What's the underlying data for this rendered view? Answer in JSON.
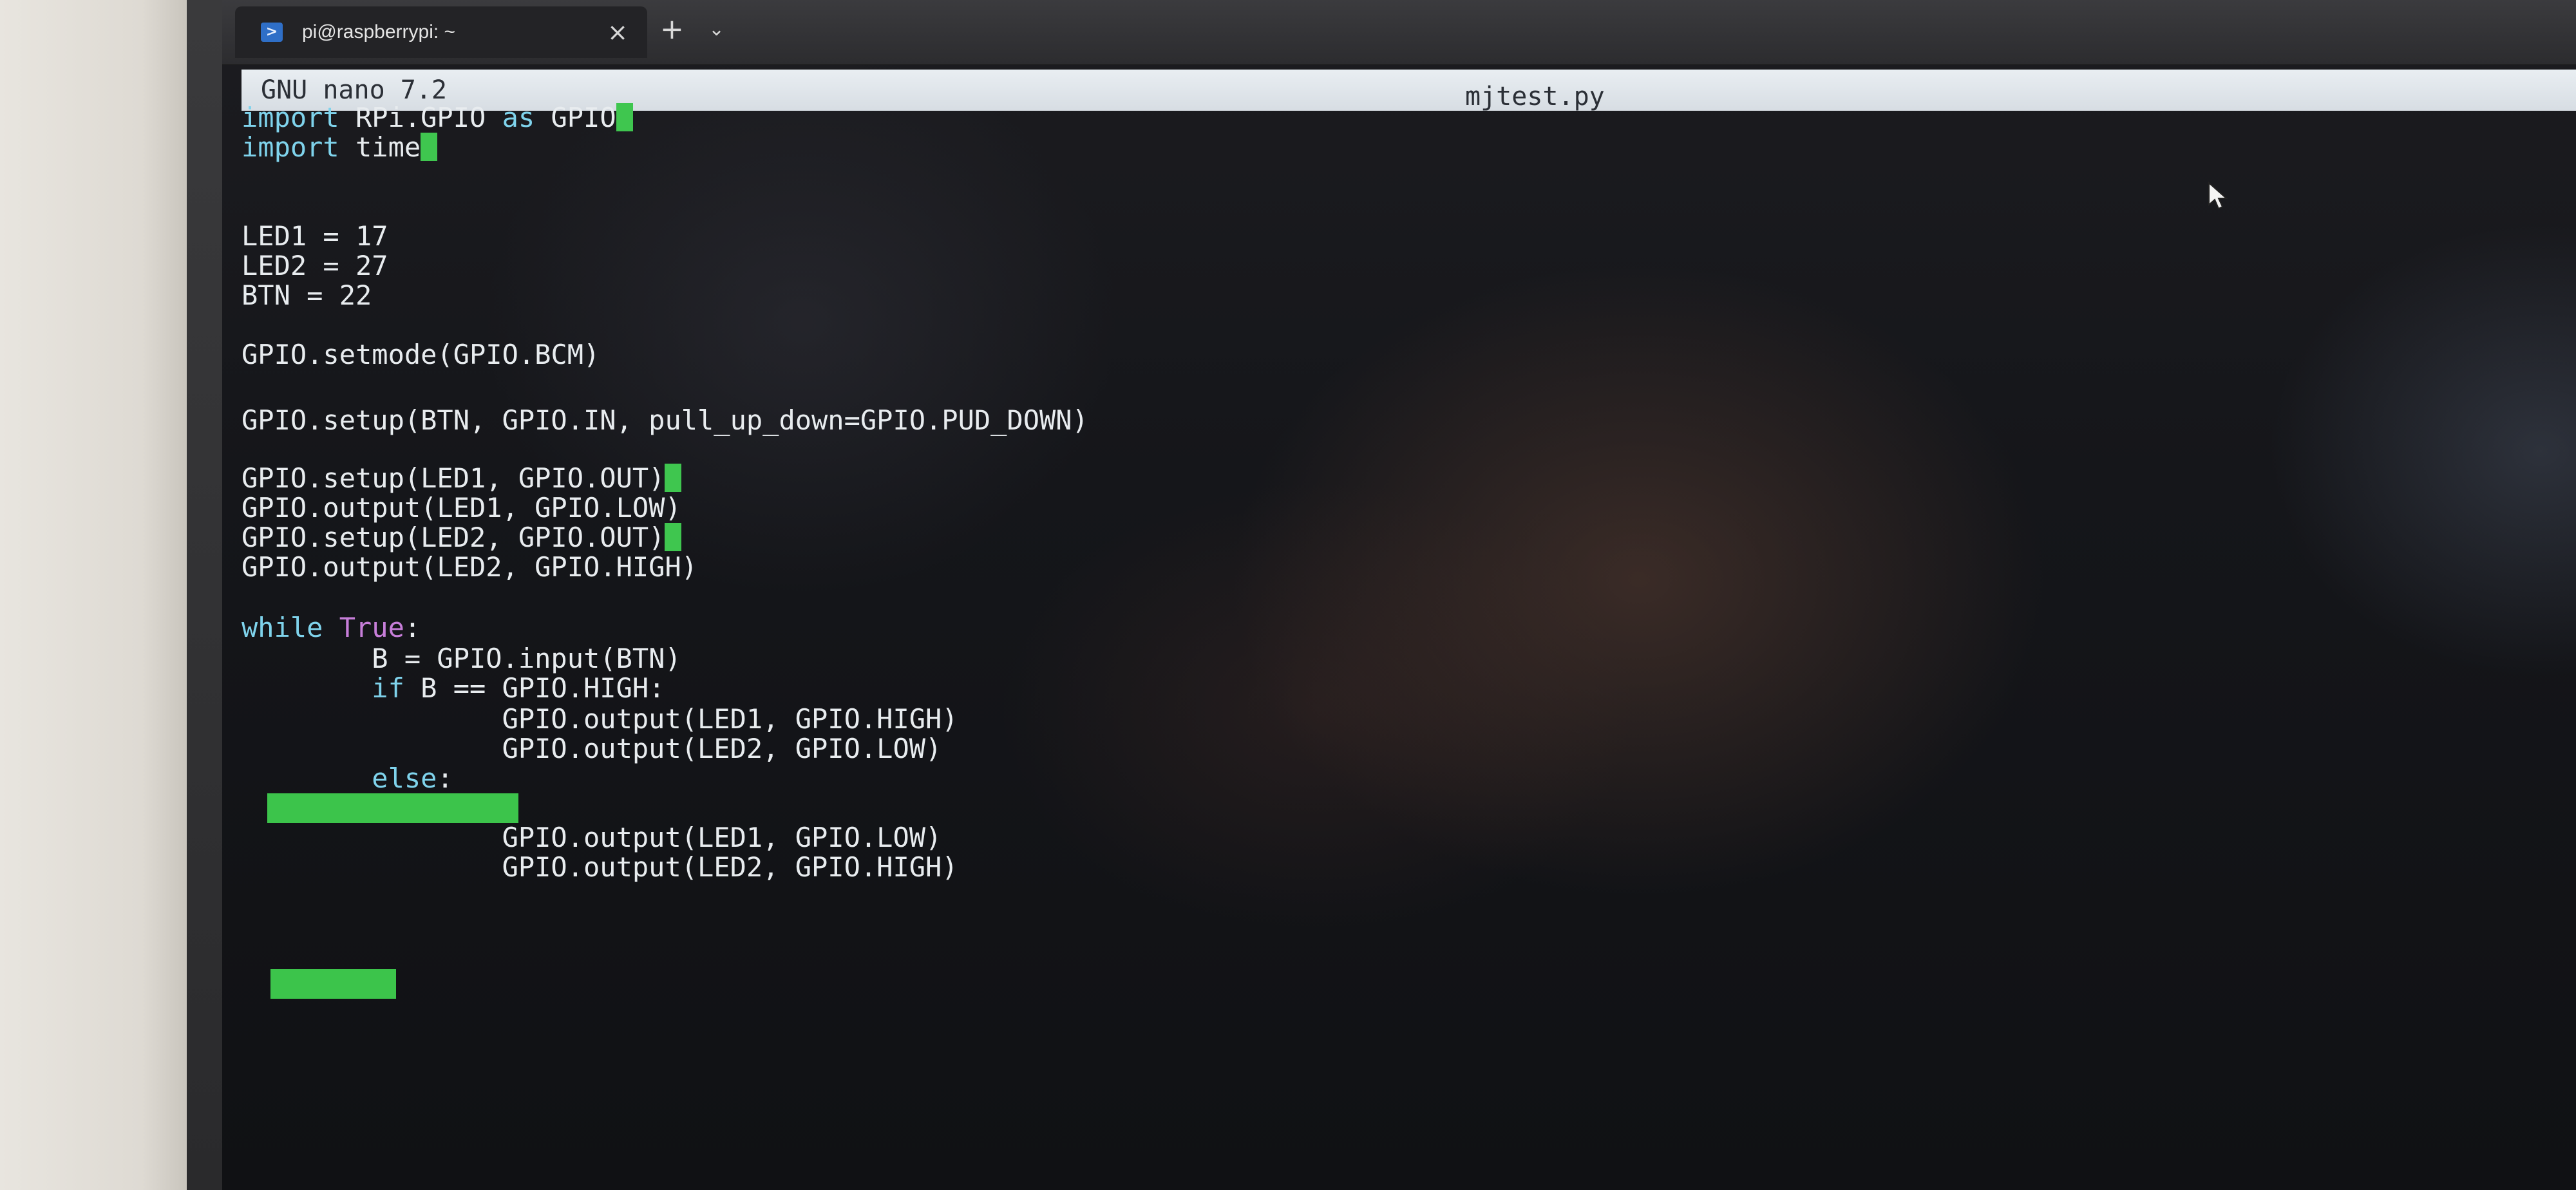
{
  "window": {
    "tab_title": "pi@raspberrypi: ~",
    "tab_icon": "powershell-icon",
    "close_icon": "×",
    "new_tab_icon": "+",
    "tab_menu_icon": "⌄"
  },
  "nano": {
    "version": "GNU nano 7.2",
    "filename": "mjtest.py"
  },
  "code": {
    "l1_import": "import",
    "l1_rest": " RPi.GPIO ",
    "l1_as": "as",
    "l1_end": " GPIO",
    "l2_import": "import",
    "l2_rest": " time",
    "l5": "LED1 = 17",
    "l6": "LED2 = 27",
    "l7": "BTN = 22",
    "l9": "GPIO.setmode(GPIO.BCM)",
    "l11": "GPIO.setup(BTN, GPIO.IN, pull_up_down=GPIO.PUD_DOWN)",
    "l13": "GPIO.setup(LED1, GPIO.OUT)",
    "l14": "GPIO.output(LED1, GPIO.LOW)",
    "l15": "GPIO.setup(LED2, GPIO.OUT)",
    "l16": "GPIO.output(LED2, GPIO.HIGH)",
    "l18_while": "while",
    "l18_true": "True",
    "l18_colon": ":",
    "l19": "        B = GPIO.input(BTN)",
    "l20_indent": "        ",
    "l20_if": "if",
    "l20_rest": " B == GPIO.HIGH:",
    "l21": "                GPIO.output(LED1, GPIO.HIGH)",
    "l22": "                GPIO.output(LED2, GPIO.LOW)",
    "l23_indent": "        ",
    "l23_else": "else",
    "l23_colon": ":",
    "l25": "                GPIO.output(LED1, GPIO.LOW)",
    "l26": "                GPIO.output(LED2, GPIO.HIGH)"
  },
  "colors": {
    "keyword": "#7fd3ec",
    "constant": "#c77ed9",
    "trailing_whitespace": "#3fc64f",
    "text": "#e8ecef"
  }
}
